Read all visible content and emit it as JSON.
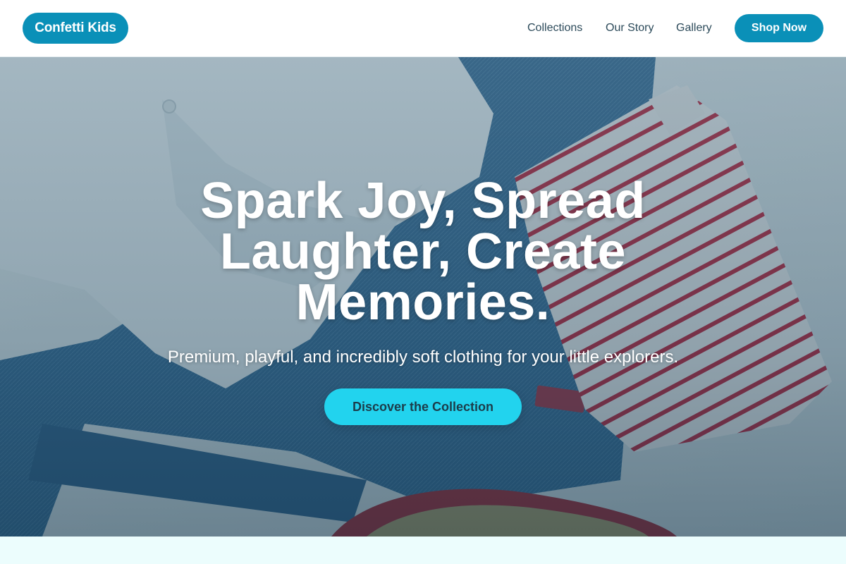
{
  "brand": {
    "name": "Confetti Kids",
    "color": "#0a90b8"
  },
  "nav": {
    "items": [
      "Collections",
      "Our Story",
      "Gallery"
    ],
    "cta_label": "Shop Now"
  },
  "hero": {
    "headline": "Spark Joy, Spread Laughter, Create Memories.",
    "subheadline": "Premium, playful, and incredibly soft clothing for your little explorers.",
    "cta_label": "Discover the Collection",
    "cta_color": "#22d3ee",
    "background_image": "flat-lay of kids clothing: white shirt, denim jeans, red striped top, red sandal"
  },
  "colors": {
    "overlay": "#14465f",
    "next_section_bg": "#ecfdfd"
  }
}
